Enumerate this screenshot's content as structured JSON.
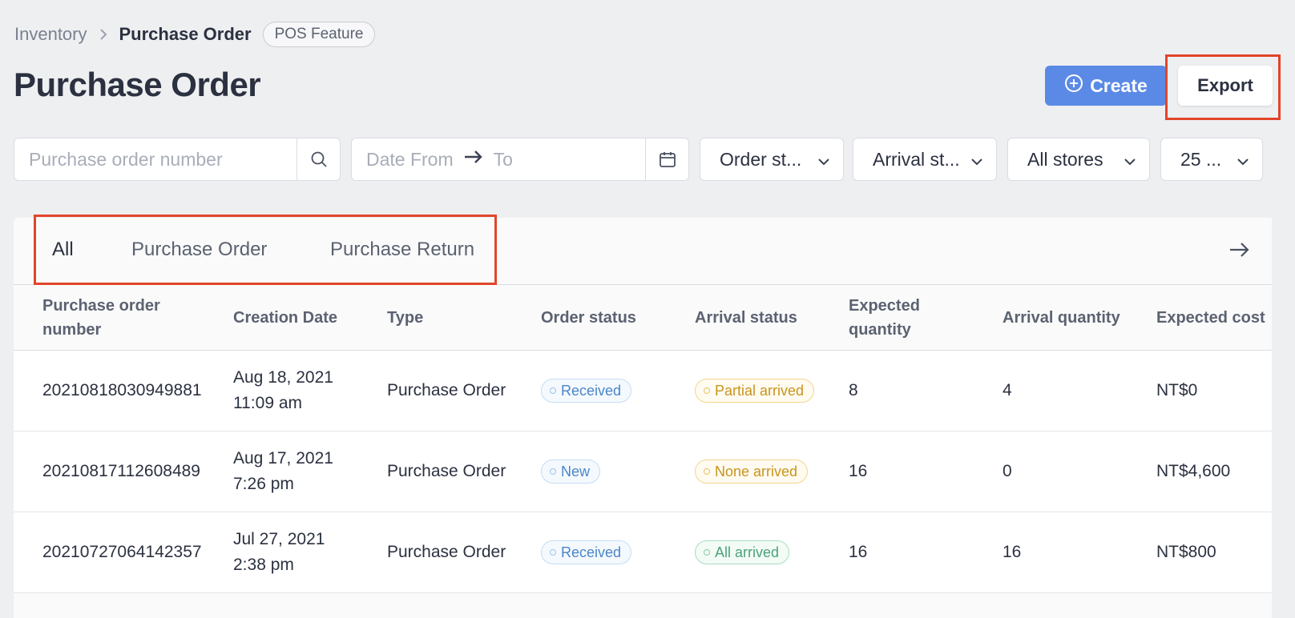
{
  "breadcrumb": {
    "parent": "Inventory",
    "current": "Purchase Order",
    "badge": "POS Feature"
  },
  "page_title": "Purchase Order",
  "actions": {
    "create_label": "Create",
    "export_label": "Export"
  },
  "filters": {
    "search_placeholder": "Purchase order number",
    "date_from_placeholder": "Date From",
    "date_to_placeholder": "To",
    "order_status": "Order st...",
    "arrival_status": "Arrival st...",
    "stores": "All stores",
    "page_size": "25 ..."
  },
  "tabs": [
    "All",
    "Purchase Order",
    "Purchase Return"
  ],
  "columns": [
    "Purchase order number",
    "Creation Date",
    "Type",
    "Order status",
    "Arrival status",
    "Expected quantity",
    "Arrival quantity",
    "Expected cost"
  ],
  "rows": [
    {
      "number": "20210818030949881",
      "date": "Aug 18, 2021",
      "time": "11:09 am",
      "type": "Purchase Order",
      "order_status": "Received",
      "arrival_status": "Partial arrived",
      "expected_qty": "8",
      "arrival_qty": "4",
      "expected_cost": "NT$0"
    },
    {
      "number": "20210817112608489",
      "date": "Aug 17, 2021",
      "time": "7:26 pm",
      "type": "Purchase Order",
      "order_status": "New",
      "arrival_status": "None arrived",
      "expected_qty": "16",
      "arrival_qty": "0",
      "expected_cost": "NT$4,600"
    },
    {
      "number": "20210727064142357",
      "date": "Jul 27, 2021",
      "time": "2:38 pm",
      "type": "Purchase Order",
      "order_status": "Received",
      "arrival_status": "All arrived",
      "expected_qty": "16",
      "arrival_qty": "16",
      "expected_cost": "NT$800"
    }
  ],
  "colors": {
    "primary": "#5b8ae6",
    "highlight": "#e2452a",
    "status_blue": "#4a86c8",
    "status_yellow": "#c8941e",
    "status_green": "#4aa37a"
  },
  "icons": {
    "search": "search-icon",
    "calendar": "calendar-icon",
    "chevron": "chevron-down-icon",
    "plus": "plus-circle-icon",
    "arrow": "arrow-right-icon"
  }
}
